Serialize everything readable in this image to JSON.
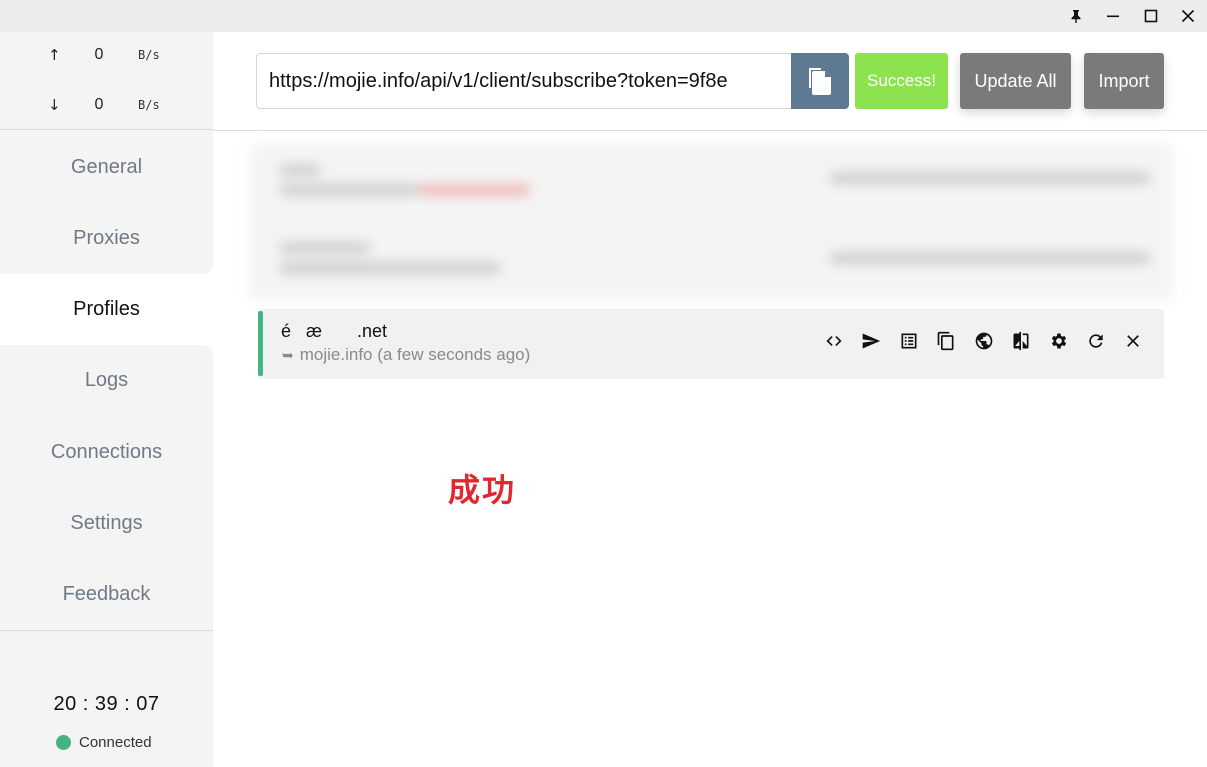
{
  "window": {
    "controls": [
      "pin-icon",
      "minimize-icon",
      "maximize-icon",
      "close-icon"
    ]
  },
  "traffic": {
    "up_arrow": "↑",
    "up_value": "0",
    "up_unit": "B/s",
    "down_arrow": "↓",
    "down_value": "0",
    "down_unit": "B/s"
  },
  "nav": {
    "items": [
      {
        "label": "General"
      },
      {
        "label": "Proxies"
      },
      {
        "label": "Profiles"
      },
      {
        "label": "Logs"
      },
      {
        "label": "Connections"
      },
      {
        "label": "Settings"
      },
      {
        "label": "Feedback"
      }
    ],
    "active": "Profiles"
  },
  "footer": {
    "clock": "20 : 39 : 07",
    "status": "Connected",
    "status_color": "#43b582"
  },
  "toolbar": {
    "url_value": "https://mojie.info/api/v1/client/subscribe?token=9f8e",
    "success_label": "Success!",
    "update_all_label": "Update All",
    "import_label": "Import"
  },
  "profile": {
    "name": "é   æ       .net",
    "source_icon": "share-arrow-icon",
    "source": "mojie.info (a few seconds ago)",
    "actions": [
      "code-icon",
      "send-icon",
      "list-icon",
      "copy-icon",
      "globe-icon",
      "compare-icon",
      "gear-icon",
      "refresh-icon",
      "close-icon"
    ],
    "accent_color": "#43b582"
  },
  "message": {
    "text": "成功",
    "color": "#e0282e"
  }
}
